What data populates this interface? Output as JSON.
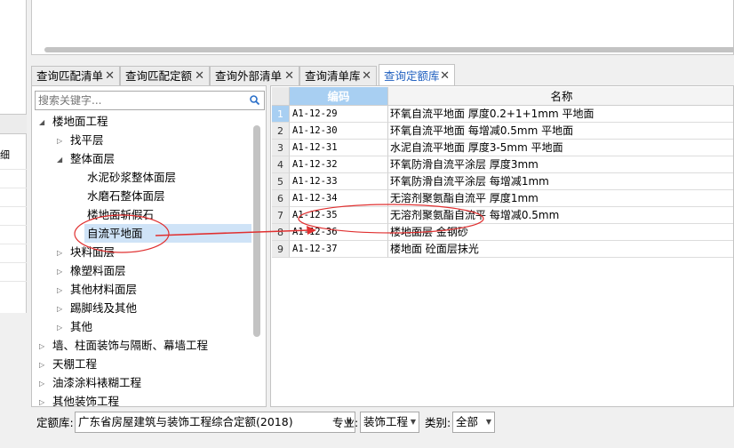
{
  "tabs": [
    {
      "label": "查询匹配清单",
      "active": false
    },
    {
      "label": "查询匹配定额",
      "active": false
    },
    {
      "label": "查询外部清单",
      "active": false
    },
    {
      "label": "查询清单库",
      "active": false
    },
    {
      "label": "查询定额库",
      "active": true
    }
  ],
  "tab_close_glyph": "✕",
  "left_strip": {
    "cell_text": "细"
  },
  "search": {
    "placeholder": "搜索关键字..."
  },
  "tree": [
    {
      "label": "楼地面工程",
      "toggle": "expanded"
    },
    {
      "label": "找平层",
      "toggle": "collapsed"
    },
    {
      "label": "整体面层",
      "toggle": "expanded"
    },
    {
      "label": "水泥砂浆整体面层",
      "toggle": "none"
    },
    {
      "label": "水磨石整体面层",
      "toggle": "none"
    },
    {
      "label": "楼地面斩假石",
      "toggle": "none"
    },
    {
      "label": "自流平地面",
      "toggle": "none",
      "selected": true
    },
    {
      "label": "块料面层",
      "toggle": "collapsed"
    },
    {
      "label": "橡塑料面层",
      "toggle": "collapsed"
    },
    {
      "label": "其他材料面层",
      "toggle": "collapsed"
    },
    {
      "label": "踢脚线及其他",
      "toggle": "collapsed"
    },
    {
      "label": "其他",
      "toggle": "collapsed"
    },
    {
      "label": "墙、柱面装饰与隔断、幕墙工程",
      "toggle": "collapsed"
    },
    {
      "label": "天棚工程",
      "toggle": "collapsed"
    },
    {
      "label": "油漆涂料裱糊工程",
      "toggle": "collapsed"
    },
    {
      "label": "其他装饰工程",
      "toggle": "collapsed"
    }
  ],
  "grid": {
    "headers": {
      "code": "编码",
      "name": "名称"
    },
    "rows": [
      {
        "no": "1",
        "code": "A1-12-29",
        "name": "环氧自流平地面 厚度0.2+1+1mm 平地面"
      },
      {
        "no": "2",
        "code": "A1-12-30",
        "name": "环氧自流平地面 每增减0.5mm 平地面"
      },
      {
        "no": "3",
        "code": "A1-12-31",
        "name": "水泥自流平地面 厚度3-5mm 平地面"
      },
      {
        "no": "4",
        "code": "A1-12-32",
        "name": "环氧防滑自流平涂层 厚度3mm"
      },
      {
        "no": "5",
        "code": "A1-12-33",
        "name": "环氧防滑自流平涂层 每增减1mm"
      },
      {
        "no": "6",
        "code": "A1-12-34",
        "name": "无溶剂聚氨酯自流平 厚度1mm"
      },
      {
        "no": "7",
        "code": "A1-12-35",
        "name": "无溶剂聚氨酯自流平 每增减0.5mm"
      },
      {
        "no": "8",
        "code": "A1-12-36",
        "name": "楼地面层 金钢砂"
      },
      {
        "no": "9",
        "code": "A1-12-37",
        "name": "楼地面 砼面层抹光"
      }
    ],
    "current_row": "1"
  },
  "bottom": {
    "quota_label": "定额库:",
    "quota_value": "广东省房屋建筑与装饰工程综合定额(2018)",
    "major_label": "专业:",
    "major_value": "装饰工程",
    "category_label": "类别:",
    "category_value": "全部"
  },
  "annotation_color": "#e03030"
}
